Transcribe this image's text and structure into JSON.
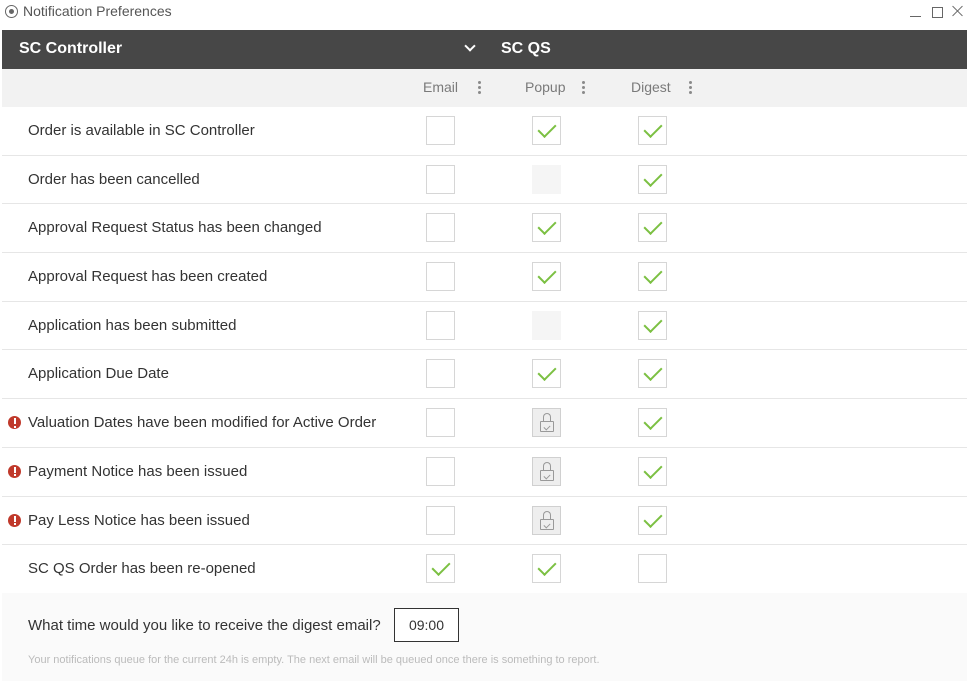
{
  "window": {
    "title": "Notification Preferences"
  },
  "header": {
    "controller_label": "SC Controller",
    "sub_label": "SC QS"
  },
  "columns": [
    "Email",
    "Popup",
    "Digest"
  ],
  "rows": [
    {
      "label": "Order is available in SC Controller",
      "warning": false,
      "email": "unchecked",
      "popup": "checked",
      "digest": "checked"
    },
    {
      "label": "Order has been cancelled",
      "warning": false,
      "email": "unchecked",
      "popup": "disabled",
      "digest": "checked"
    },
    {
      "label": "Approval Request Status has been changed",
      "warning": false,
      "email": "unchecked",
      "popup": "checked",
      "digest": "checked"
    },
    {
      "label": "Approval Request has been created",
      "warning": false,
      "email": "unchecked",
      "popup": "checked",
      "digest": "checked"
    },
    {
      "label": "Application has been submitted",
      "warning": false,
      "email": "unchecked",
      "popup": "disabled",
      "digest": "checked"
    },
    {
      "label": "Application Due Date",
      "warning": false,
      "email": "unchecked",
      "popup": "checked",
      "digest": "checked"
    },
    {
      "label": "Valuation Dates have been modified for Active Order",
      "warning": true,
      "email": "unchecked",
      "popup": "locked",
      "digest": "checked"
    },
    {
      "label": "Payment Notice has been issued",
      "warning": true,
      "email": "unchecked",
      "popup": "locked",
      "digest": "checked"
    },
    {
      "label": "Pay Less Notice has been issued",
      "warning": true,
      "email": "unchecked",
      "popup": "locked",
      "digest": "checked"
    },
    {
      "label": "SC QS Order has been re-opened",
      "warning": false,
      "email": "checked",
      "popup": "checked",
      "digest": "unchecked"
    }
  ],
  "footer": {
    "digest_question": "What time would you like to receive the digest email?",
    "digest_time": "09:00",
    "queue_note": "Your notifications queue for the current 24h is empty. The next email will be queued once there is something to report."
  },
  "colors": {
    "header_bg": "#474747",
    "check_green": "#7cc043",
    "warning_red": "#c0392b"
  }
}
